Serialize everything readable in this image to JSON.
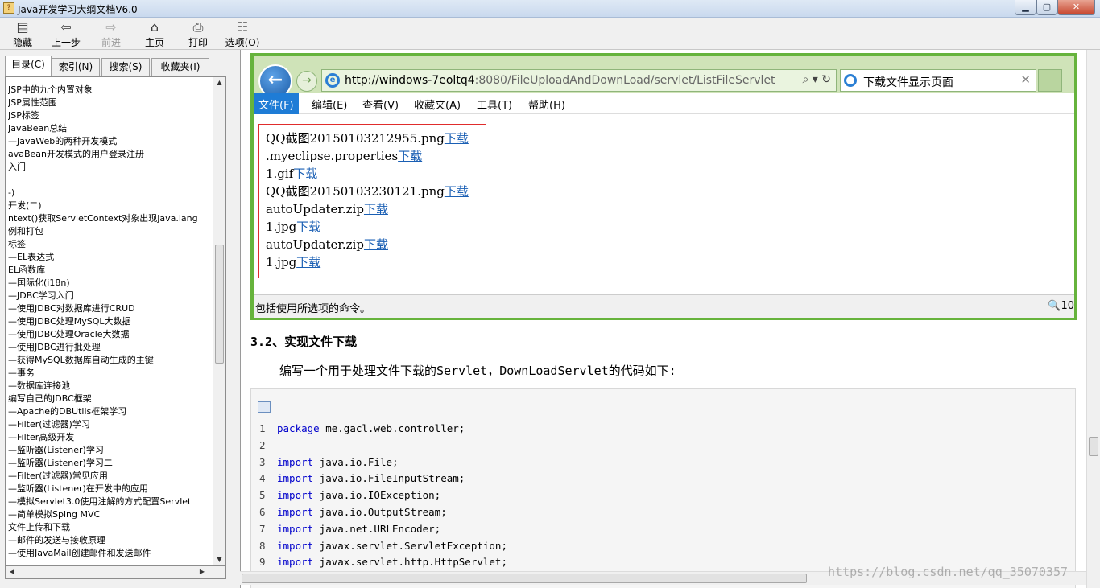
{
  "window": {
    "title": "Java开发学习大纲文档V6.0",
    "min_glyph": "▁",
    "max_glyph": "▢",
    "close_glyph": "✕"
  },
  "toolbar": {
    "hide": "隐藏",
    "back": "上一步",
    "forward": "前进",
    "home": "主页",
    "print": "打印",
    "options": "选项(O)"
  },
  "tabs": [
    {
      "label": "目录(C)"
    },
    {
      "label": "索引(N)"
    },
    {
      "label": "搜索(S)"
    },
    {
      "label": "收藏夹(I)"
    }
  ],
  "tree": {
    "items": [
      "JSP中的九个内置对象",
      "JSP属性范围",
      "JSP标签",
      "JavaBean总结",
      "—JavaWeb的两种开发模式",
      "avaBean开发模式的用户登录注册",
      "入门",
      "",
      "-)",
      "开发(二)",
      "ntext()获取ServletContext对象出现java.lang",
      "例和打包",
      "标签",
      "—EL表达式",
      "EL函数库",
      "—国际化(i18n)",
      "—JDBC学习入门",
      "—使用JDBC对数据库进行CRUD",
      "—使用JDBC处理MySQL大数据",
      "—使用JDBC处理Oracle大数据",
      "—使用JDBC进行批处理",
      "—获得MySQL数据库自动生成的主键",
      "—事务",
      "—数据库连接池",
      "编写自己的JDBC框架",
      "—Apache的DBUtils框架学习",
      "—Filter(过滤器)学习",
      "—Filter高级开发",
      "—监听器(Listener)学习",
      "—监听器(Listener)学习二",
      "—Filter(过滤器)常见应用",
      "—监听器(Listener)在开发中的应用",
      "—模拟Servlet3.0使用注解的方式配置Servlet",
      "—简单模拟Sping MVC",
      "文件上传和下载",
      "—邮件的发送与接收原理",
      "—使用JavaMail创建邮件和发送邮件"
    ]
  },
  "browser": {
    "url_host": "http://windows-7eoltq4",
    "url_rest": ":8080/FileUploadAndDownLoad/servlet/ListFileServlet",
    "url_ctrls": "⌕ ▾ ↻",
    "tab_title": "下载文件显示页面",
    "tab_close": "✕",
    "menus": [
      {
        "label": "文件(F)"
      },
      {
        "label": "编辑(E)"
      },
      {
        "label": "查看(V)"
      },
      {
        "label": "收藏夹(A)"
      },
      {
        "label": "工具(T)"
      },
      {
        "label": "帮助(H)"
      }
    ],
    "files": [
      {
        "name": "QQ截图20150103212955.png",
        "link": "下载"
      },
      {
        "name": ".myeclipse.properties",
        "link": "下载"
      },
      {
        "name": "1.gif",
        "link": "下载"
      },
      {
        "name": "QQ截图20150103230121.png",
        "link": "下载"
      },
      {
        "name": "autoUpdater.zip",
        "link": "下载"
      },
      {
        "name": "1.jpg",
        "link": "下载"
      },
      {
        "name": "autoUpdater.zip",
        "link": "下载"
      },
      {
        "name": "1.jpg",
        "link": "下载"
      }
    ],
    "status": "包括使用所选项的命令。",
    "zoom": "🔍10"
  },
  "doc": {
    "heading": "3.2、实现文件下载",
    "paragraph": "编写一个用于处理文件下载的Servlet，DownLoadServlet的代码如下:",
    "code": [
      {
        "n": "1",
        "kw": "package",
        "rest": " me.gacl.web.controller;"
      },
      {
        "n": "2",
        "kw": "",
        "rest": ""
      },
      {
        "n": "3",
        "kw": "import",
        "rest": " java.io.File;"
      },
      {
        "n": "4",
        "kw": "import",
        "rest": " java.io.FileInputStream;"
      },
      {
        "n": "5",
        "kw": "import",
        "rest": " java.io.IOException;"
      },
      {
        "n": "6",
        "kw": "import",
        "rest": " java.io.OutputStream;"
      },
      {
        "n": "7",
        "kw": "import",
        "rest": " java.net.URLEncoder;"
      },
      {
        "n": "8",
        "kw": "import",
        "rest": " javax.servlet.ServletException;"
      },
      {
        "n": "9",
        "kw": "import",
        "rest": " javax.servlet.http.HttpServlet;"
      }
    ]
  },
  "watermark": "https://blog.csdn.net/qq_35070357",
  "scroll": {
    "tree_position": 0.45,
    "content_position": 0.77
  }
}
